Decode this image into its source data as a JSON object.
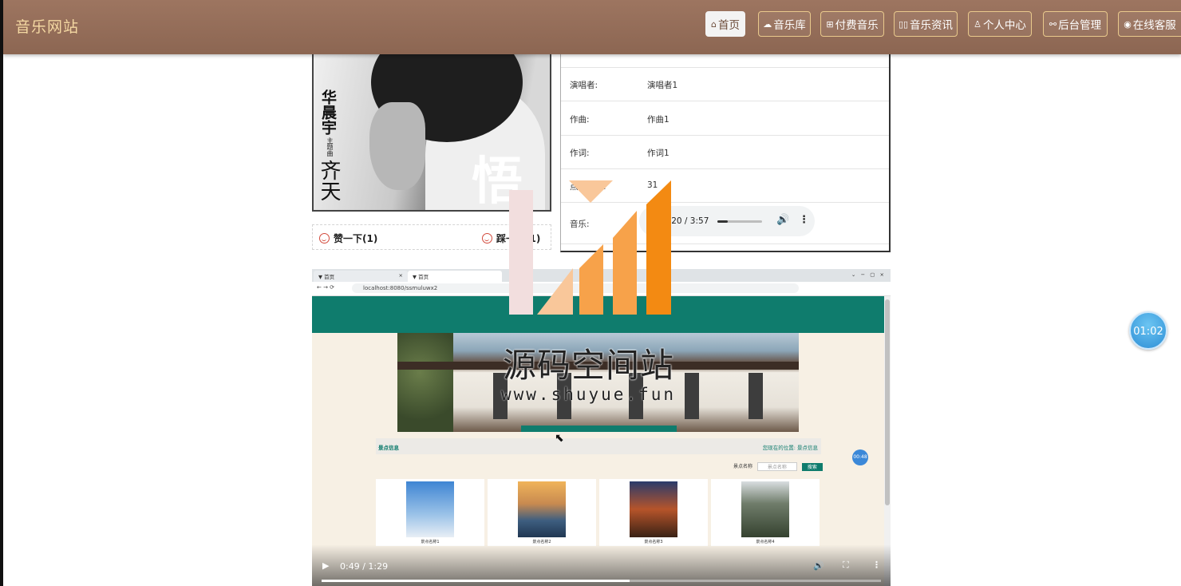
{
  "brand": "音乐网站",
  "nav": [
    {
      "label": "首页",
      "icon": "home-icon",
      "glyph": "⌂",
      "active": true
    },
    {
      "label": "音乐库",
      "icon": "cloud-icon",
      "glyph": "☁",
      "active": false
    },
    {
      "label": "付费音乐",
      "icon": "grid-icon",
      "glyph": "⊞",
      "active": false
    },
    {
      "label": "音乐资讯",
      "icon": "book-icon",
      "glyph": "▯▯",
      "active": false
    },
    {
      "label": "个人中心",
      "icon": "user-icon",
      "glyph": "♙",
      "active": false
    },
    {
      "label": "后台管理",
      "icon": "link-icon",
      "glyph": "⚯",
      "active": false
    },
    {
      "label": "在线客服",
      "icon": "chat-icon",
      "glyph": "◉",
      "active": false
    }
  ],
  "cover": {
    "artist_text": "华晨宇",
    "subtitle_text": "主题曲",
    "song_text": "齐天",
    "brush_text": "悟"
  },
  "votes": {
    "like": "赞一下(1)",
    "dislike": "踩一下(1)"
  },
  "details": [
    {
      "key": "演唱者:",
      "value": "演唱者1"
    },
    {
      "key": "作曲:",
      "value": "作曲1"
    },
    {
      "key": "作词:",
      "value": "作词1"
    },
    {
      "key": "点击次数:",
      "value": "31"
    }
  ],
  "audio": {
    "label": "音乐:",
    "time": "0:20 / 3:57",
    "progress": 0.084
  },
  "video": {
    "tab1": "首页",
    "tab2": "首页",
    "url": "localhost:8080/ssmuluwx2",
    "panel_title": "景点信息",
    "panel_breadcrumb": "您现在的位置: 景点信息",
    "search_label": "景点名称",
    "search_placeholder": "景点名称",
    "search_button": "搜索",
    "badge": "00:48",
    "cards": [
      "景点名称1",
      "景点名称2",
      "景点名称3",
      "景点名称4"
    ],
    "time": "0:49 / 1:29",
    "progress": 0.551
  },
  "watermark": {
    "title": "源码空间站",
    "url": "www.shuyue.fun",
    "colors": {
      "pale": "#f2dede",
      "light": "#f9c79a",
      "mid": "#f7a24a",
      "strong": "#f38a12"
    }
  },
  "timer": "01:02"
}
